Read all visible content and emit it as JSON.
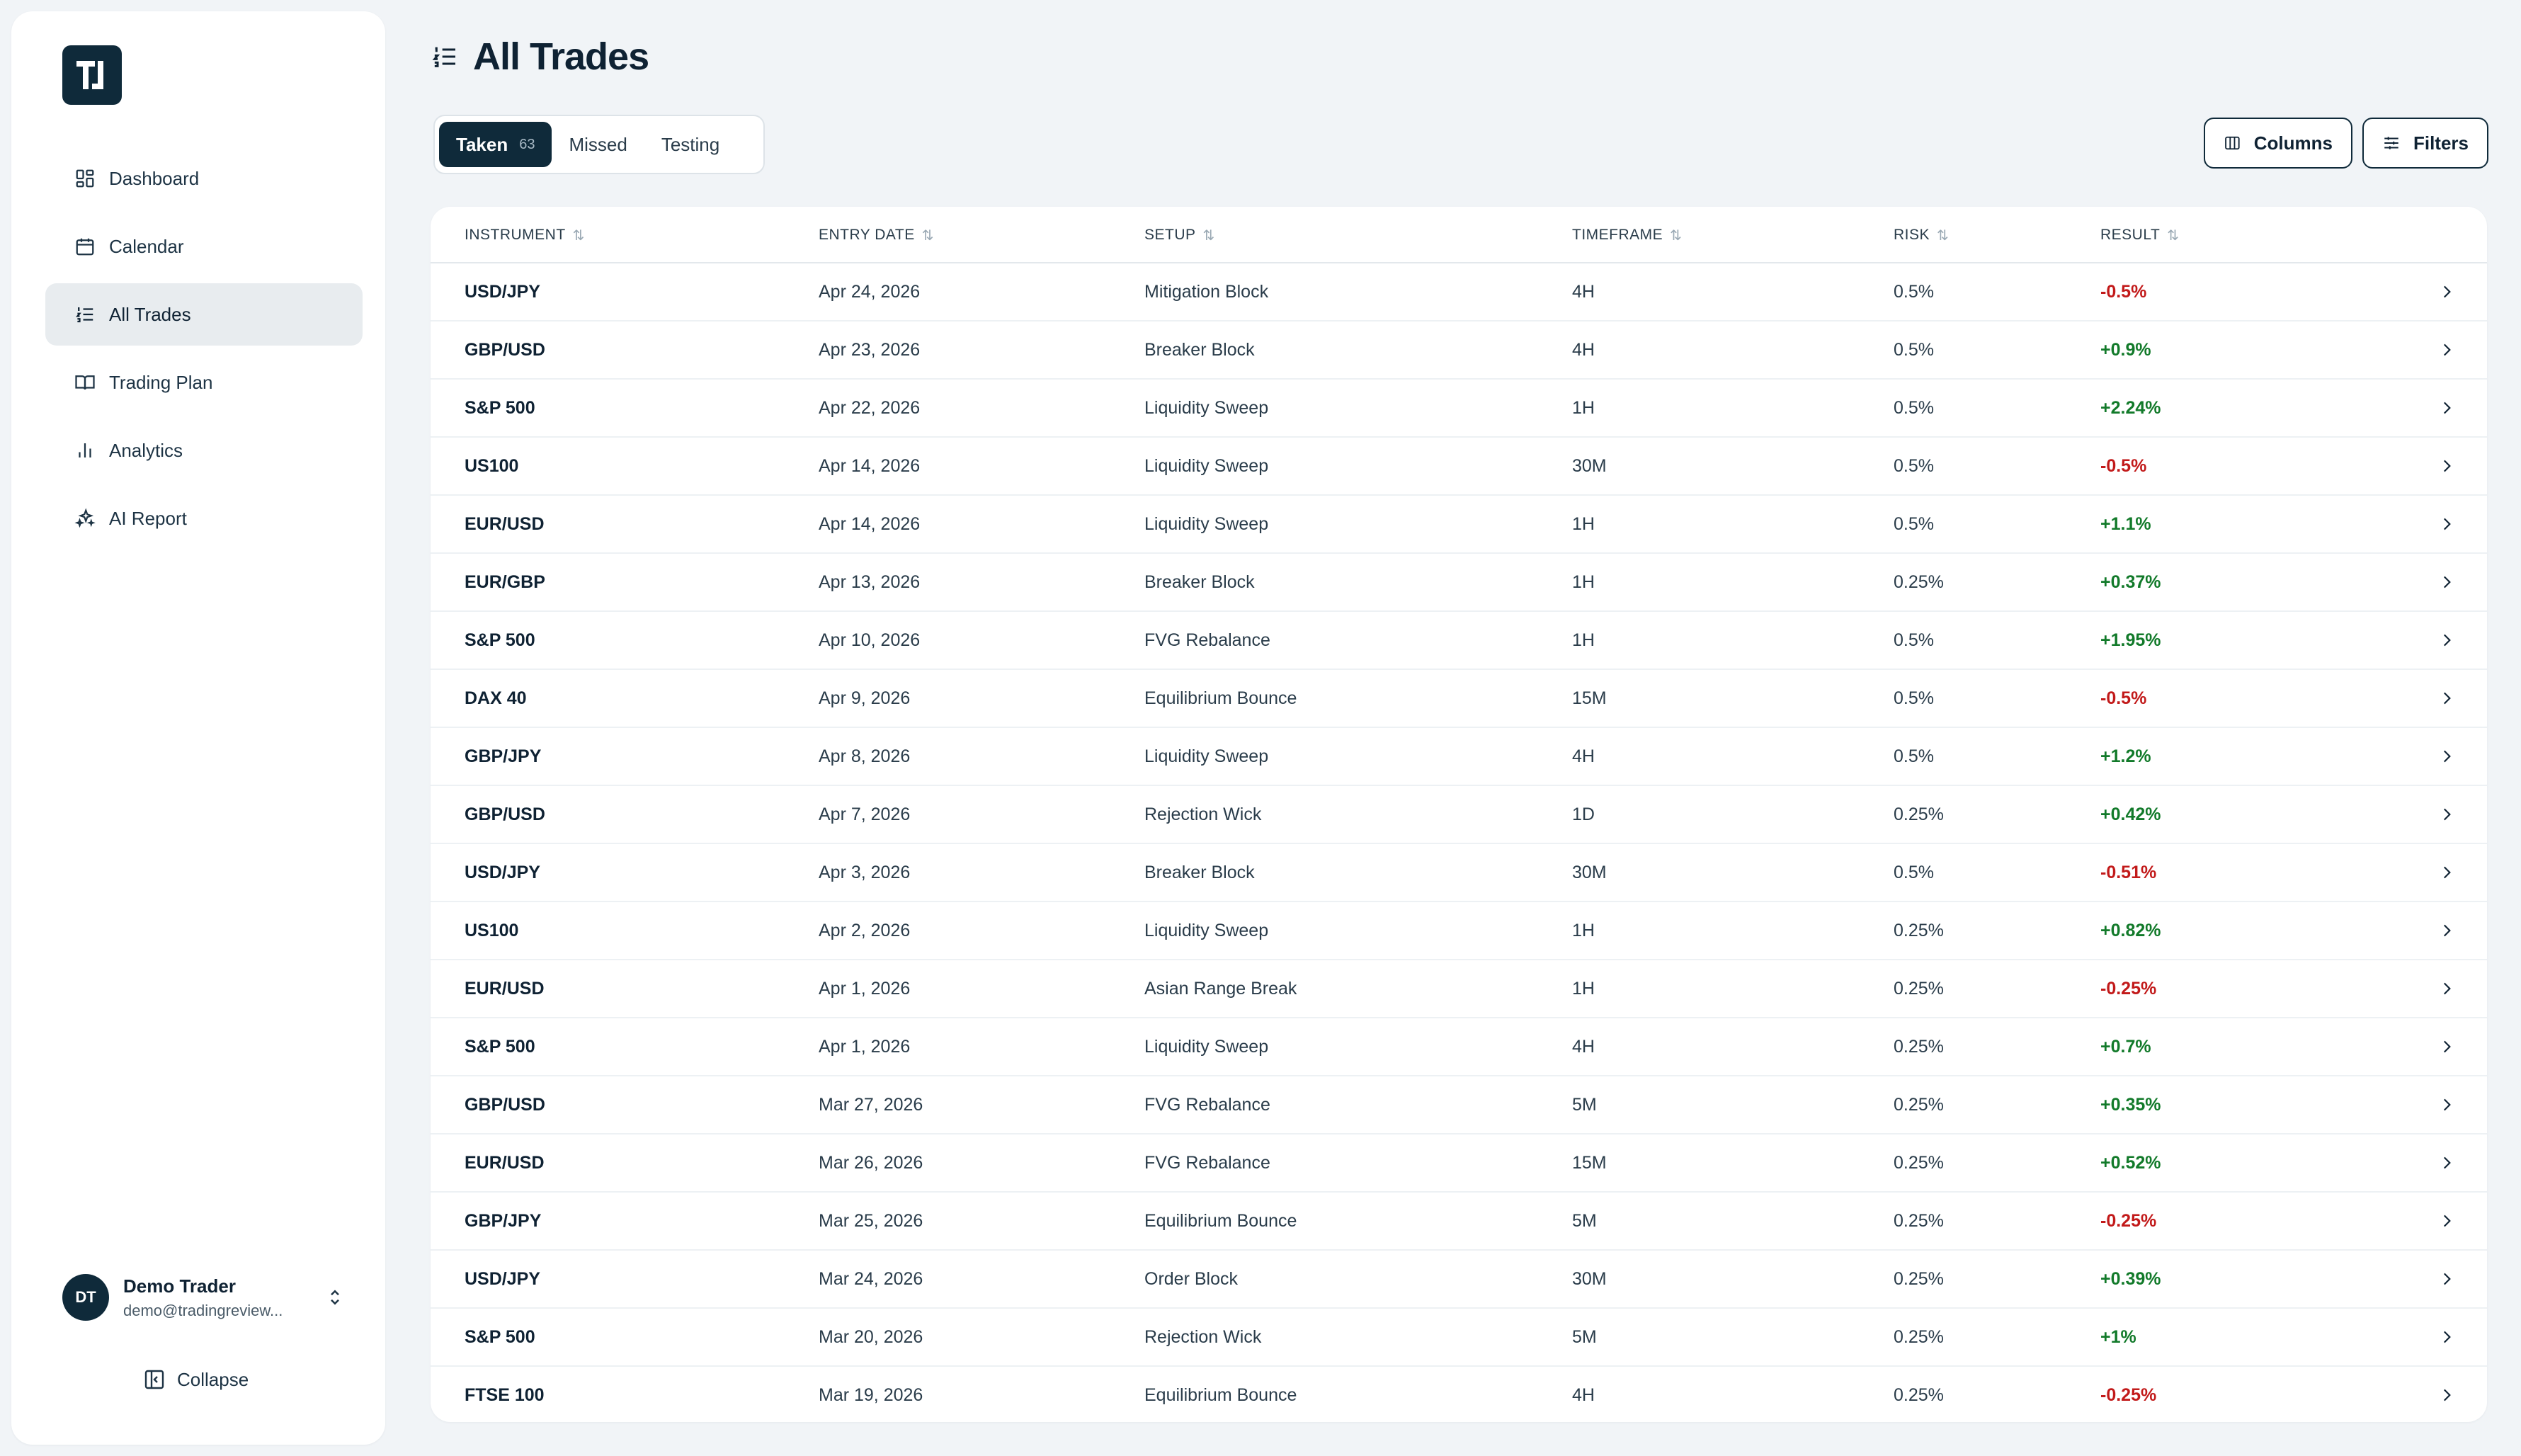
{
  "app": {
    "logo_text": "TJ",
    "brand_color": "#0f2a3a"
  },
  "sidebar": {
    "items": [
      {
        "label": "Dashboard",
        "icon": "dashboard-icon",
        "active": false
      },
      {
        "label": "Calendar",
        "icon": "calendar-icon",
        "active": false
      },
      {
        "label": "All Trades",
        "icon": "list-icon",
        "active": true
      },
      {
        "label": "Trading Plan",
        "icon": "book-icon",
        "active": false
      },
      {
        "label": "Analytics",
        "icon": "bar-chart-icon",
        "active": false
      },
      {
        "label": "AI Report",
        "icon": "sparkles-icon",
        "active": false
      }
    ],
    "user": {
      "initials": "DT",
      "name": "Demo Trader",
      "email": "demo@tradingreview..."
    },
    "collapse_label": "Collapse"
  },
  "page": {
    "title": "All Trades"
  },
  "tabs": [
    {
      "label": "Taken",
      "count": "63",
      "active": true
    },
    {
      "label": "Missed",
      "active": false
    },
    {
      "label": "Testing",
      "active": false
    }
  ],
  "toolbar": {
    "columns_label": "Columns",
    "filters_label": "Filters"
  },
  "table": {
    "headers": {
      "instrument": "INSTRUMENT",
      "entry_date": "ENTRY DATE",
      "setup": "SETUP",
      "timeframe": "TIMEFRAME",
      "risk": "RISK",
      "result": "RESULT"
    },
    "sort_glyph": "⇅",
    "rows": [
      {
        "instrument": "USD/JPY",
        "date": "Apr 24, 2026",
        "setup": "Mitigation Block",
        "timeframe": "4H",
        "risk": "0.5%",
        "result": "-0.5%",
        "sign": "neg"
      },
      {
        "instrument": "GBP/USD",
        "date": "Apr 23, 2026",
        "setup": "Breaker Block",
        "timeframe": "4H",
        "risk": "0.5%",
        "result": "+0.9%",
        "sign": "pos"
      },
      {
        "instrument": "S&P 500",
        "date": "Apr 22, 2026",
        "setup": "Liquidity Sweep",
        "timeframe": "1H",
        "risk": "0.5%",
        "result": "+2.24%",
        "sign": "pos"
      },
      {
        "instrument": "US100",
        "date": "Apr 14, 2026",
        "setup": "Liquidity Sweep",
        "timeframe": "30M",
        "risk": "0.5%",
        "result": "-0.5%",
        "sign": "neg"
      },
      {
        "instrument": "EUR/USD",
        "date": "Apr 14, 2026",
        "setup": "Liquidity Sweep",
        "timeframe": "1H",
        "risk": "0.5%",
        "result": "+1.1%",
        "sign": "pos"
      },
      {
        "instrument": "EUR/GBP",
        "date": "Apr 13, 2026",
        "setup": "Breaker Block",
        "timeframe": "1H",
        "risk": "0.25%",
        "result": "+0.37%",
        "sign": "pos"
      },
      {
        "instrument": "S&P 500",
        "date": "Apr 10, 2026",
        "setup": "FVG Rebalance",
        "timeframe": "1H",
        "risk": "0.5%",
        "result": "+1.95%",
        "sign": "pos"
      },
      {
        "instrument": "DAX 40",
        "date": "Apr 9, 2026",
        "setup": "Equilibrium Bounce",
        "timeframe": "15M",
        "risk": "0.5%",
        "result": "-0.5%",
        "sign": "neg"
      },
      {
        "instrument": "GBP/JPY",
        "date": "Apr 8, 2026",
        "setup": "Liquidity Sweep",
        "timeframe": "4H",
        "risk": "0.5%",
        "result": "+1.2%",
        "sign": "pos"
      },
      {
        "instrument": "GBP/USD",
        "date": "Apr 7, 2026",
        "setup": "Rejection Wick",
        "timeframe": "1D",
        "risk": "0.25%",
        "result": "+0.42%",
        "sign": "pos"
      },
      {
        "instrument": "USD/JPY",
        "date": "Apr 3, 2026",
        "setup": "Breaker Block",
        "timeframe": "30M",
        "risk": "0.5%",
        "result": "-0.51%",
        "sign": "neg"
      },
      {
        "instrument": "US100",
        "date": "Apr 2, 2026",
        "setup": "Liquidity Sweep",
        "timeframe": "1H",
        "risk": "0.25%",
        "result": "+0.82%",
        "sign": "pos"
      },
      {
        "instrument": "EUR/USD",
        "date": "Apr 1, 2026",
        "setup": "Asian Range Break",
        "timeframe": "1H",
        "risk": "0.25%",
        "result": "-0.25%",
        "sign": "neg"
      },
      {
        "instrument": "S&P 500",
        "date": "Apr 1, 2026",
        "setup": "Liquidity Sweep",
        "timeframe": "4H",
        "risk": "0.25%",
        "result": "+0.7%",
        "sign": "pos"
      },
      {
        "instrument": "GBP/USD",
        "date": "Mar 27, 2026",
        "setup": "FVG Rebalance",
        "timeframe": "5M",
        "risk": "0.25%",
        "result": "+0.35%",
        "sign": "pos"
      },
      {
        "instrument": "EUR/USD",
        "date": "Mar 26, 2026",
        "setup": "FVG Rebalance",
        "timeframe": "15M",
        "risk": "0.25%",
        "result": "+0.52%",
        "sign": "pos"
      },
      {
        "instrument": "GBP/JPY",
        "date": "Mar 25, 2026",
        "setup": "Equilibrium Bounce",
        "timeframe": "5M",
        "risk": "0.25%",
        "result": "-0.25%",
        "sign": "neg"
      },
      {
        "instrument": "USD/JPY",
        "date": "Mar 24, 2026",
        "setup": "Order Block",
        "timeframe": "30M",
        "risk": "0.25%",
        "result": "+0.39%",
        "sign": "pos"
      },
      {
        "instrument": "S&P 500",
        "date": "Mar 20, 2026",
        "setup": "Rejection Wick",
        "timeframe": "5M",
        "risk": "0.25%",
        "result": "+1%",
        "sign": "pos"
      },
      {
        "instrument": "FTSE 100",
        "date": "Mar 19, 2026",
        "setup": "Equilibrium Bounce",
        "timeframe": "4H",
        "risk": "0.25%",
        "result": "-0.25%",
        "sign": "neg"
      }
    ]
  },
  "colors": {
    "positive": "#127a2a",
    "negative": "#c21a1a",
    "background": "#f1f4f7"
  }
}
